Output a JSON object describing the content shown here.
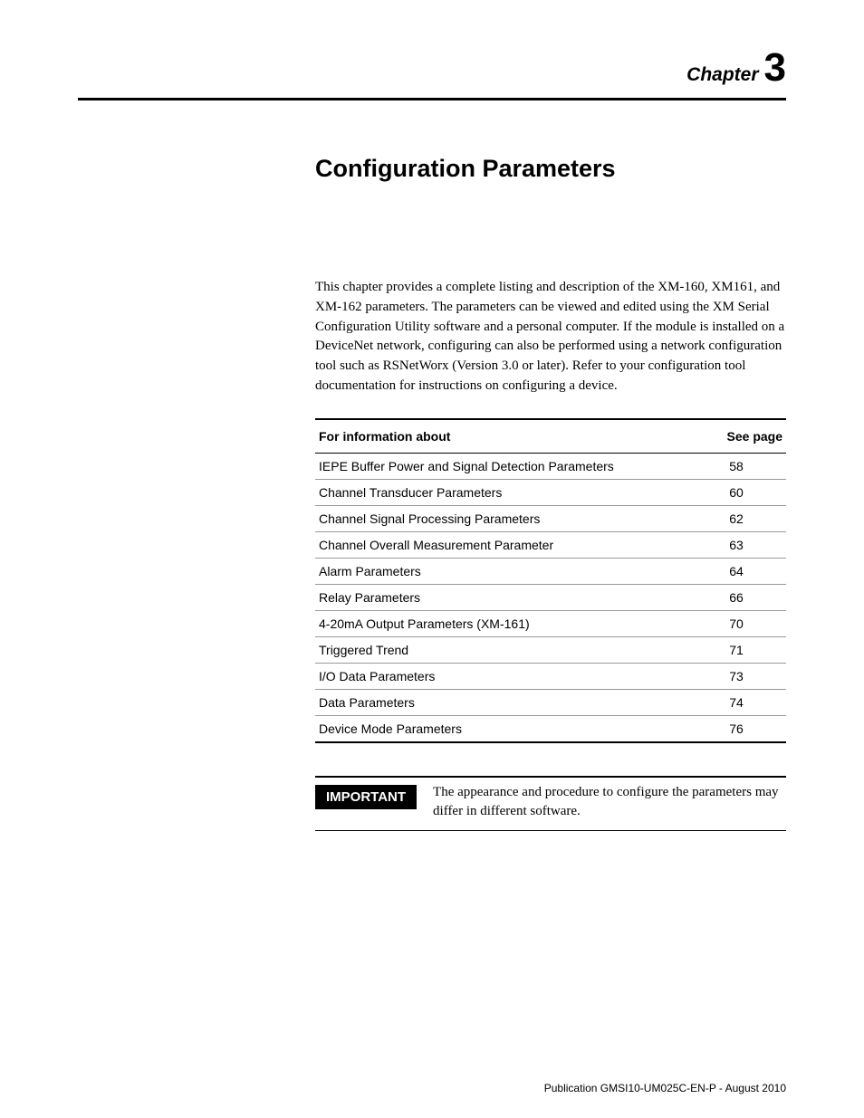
{
  "chapter": {
    "label": "Chapter",
    "number": "3"
  },
  "title": "Configuration Parameters",
  "intro": "This chapter provides a complete listing and description of the XM-160, XM161, and XM-162 parameters. The parameters can be viewed and edited using the XM Serial Configuration Utility software and a personal computer. If the module is installed on a DeviceNet network, configuring can also be performed using a network configuration tool such as RSNetWorx (Version 3.0 or later). Refer to your configuration tool documentation for instructions on configuring a device.",
  "table": {
    "header_info": "For information about",
    "header_page": "See page",
    "rows": [
      {
        "info": "IEPE Buffer Power and Signal Detection Parameters",
        "page": "58"
      },
      {
        "info": "Channel Transducer Parameters",
        "page": "60"
      },
      {
        "info": "Channel Signal Processing Parameters",
        "page": "62"
      },
      {
        "info": "Channel Overall Measurement Parameter",
        "page": "63"
      },
      {
        "info": "Alarm Parameters",
        "page": "64"
      },
      {
        "info": "Relay Parameters",
        "page": "66"
      },
      {
        "info": "4-20mA Output Parameters (XM-161)",
        "page": "70"
      },
      {
        "info": "Triggered Trend",
        "page": "71"
      },
      {
        "info": "I/O Data Parameters",
        "page": "73"
      },
      {
        "info": "Data Parameters",
        "page": "74"
      },
      {
        "info": "Device Mode Parameters",
        "page": "76"
      }
    ]
  },
  "important": {
    "label": "IMPORTANT",
    "text": "The appearance and procedure to configure the parameters may differ in different software."
  },
  "footer": "Publication GMSI10-UM025C-EN-P - August 2010"
}
